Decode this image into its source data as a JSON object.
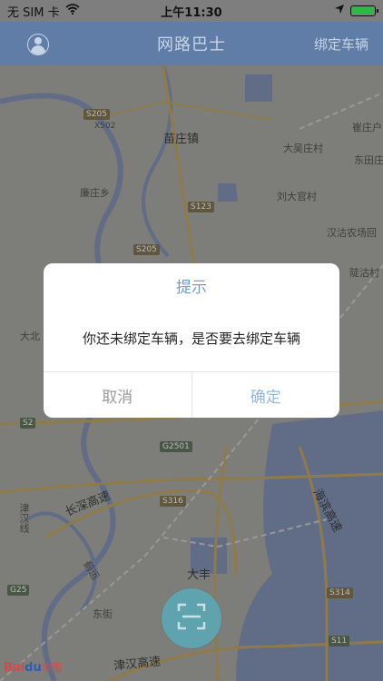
{
  "status_bar": {
    "carrier": "无 SIM 卡",
    "time": "上午11:30",
    "icons": [
      "wifi-icon",
      "location-arrow-icon",
      "battery-icon"
    ]
  },
  "nav": {
    "title": "网路巴士",
    "right_button": "绑定车辆",
    "left_icon": "user-avatar-icon"
  },
  "map": {
    "labels": [
      "苗庄镇",
      "大吴庄村",
      "崔庄户",
      "东田庄",
      "廉庄乡",
      "刘大官村",
      "汉沽农场回",
      "陡沽村",
      "大北",
      "X502",
      "津汉线",
      "东街",
      "长深高速",
      "海滨高速",
      "津汉高速",
      "蓟运",
      "大丰"
    ],
    "shields": [
      "S205",
      "S123",
      "S205",
      "S2",
      "G2501",
      "S316",
      "G25",
      "S314",
      "S11"
    ],
    "logo_text_baidu_1": "Bai",
    "logo_text_baidu_2": "du",
    "logo_text_map": "地图"
  },
  "dialog": {
    "title": "提示",
    "message": "你还未绑定车辆，是否要去绑定车辆",
    "cancel": "取消",
    "confirm": "确定"
  },
  "scan": {
    "icon": "scan-icon"
  },
  "colors": {
    "nav_bg": "#5f7da6",
    "dialog_title": "#6f9bd3",
    "confirm": "#8fb7ea",
    "scan_btn": "#5ea3ad"
  }
}
